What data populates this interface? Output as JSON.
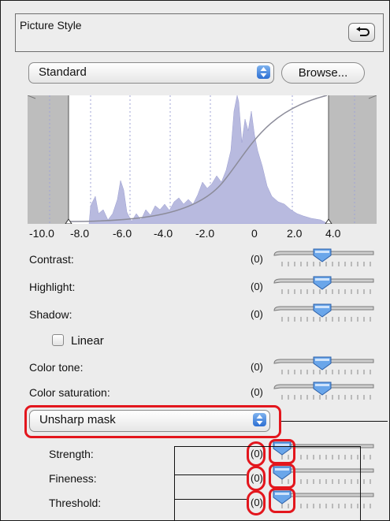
{
  "panel": {
    "title": "Picture Style",
    "back_icon": "undo-arrow-icon"
  },
  "style_select": {
    "value": "Standard"
  },
  "browse_label": "Browse...",
  "histogram": {
    "axis_labels": [
      "-10.0",
      "-8.0",
      "-6.0",
      "-4.0",
      "-2.0",
      "0",
      "2.0",
      "4.0"
    ]
  },
  "adjustments": [
    {
      "label": "Contrast:",
      "value": "(0)",
      "level": 0
    },
    {
      "label": "Highlight:",
      "value": "(0)",
      "level": 0
    },
    {
      "label": "Shadow:",
      "value": "(0)",
      "level": 0
    }
  ],
  "linear": {
    "label": "Linear",
    "checked": false
  },
  "color": [
    {
      "label": "Color tone:",
      "value": "(0)",
      "level": 0
    },
    {
      "label": "Color saturation:",
      "value": "(0)",
      "level": 0
    }
  ],
  "sharpness_select": {
    "value": "Unsharp mask"
  },
  "sharpness": [
    {
      "label": "Strength:",
      "value": "(0)",
      "level": 0
    },
    {
      "label": "Fineness:",
      "value": "(0)",
      "level": 0
    },
    {
      "label": "Threshold:",
      "value": "(0)",
      "level": 0
    }
  ],
  "highlight_color": "#e3161d"
}
